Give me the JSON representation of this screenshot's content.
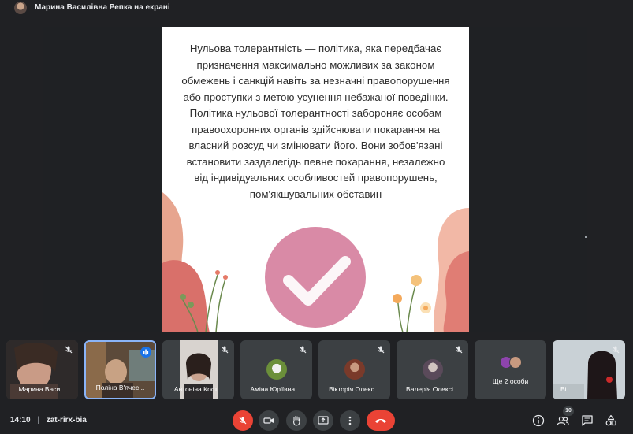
{
  "header": {
    "presenting_text": "Марина Василівна Репка на екрані"
  },
  "slide": {
    "text": "Нульова толерантність — політика, яка передбачає призначення максимально можливих за законом обмежень і санкцій навіть за незначні правопорушення або проступки з метою усунення небажаної поведінки. Політика нульової толерантності забороняє особам правоохоронних органів здійснювати покарання на власний розсуд чи змінювати його. Вони зобов'язані встановити заздалегідь певне покарання, незалежно від індивідуальних особливостей правопорушень, пом'якшувальних обставин",
    "check_color": "#d98aa6",
    "accent_color": "#e2a08f"
  },
  "participants": [
    {
      "name": "Марина Васи...",
      "muted": true
    },
    {
      "name": "Поліна В'ячес...",
      "muted": false,
      "speaking": true
    },
    {
      "name": "Антоніна Кост...",
      "muted": true
    },
    {
      "name": "Аміна Юріївна ...",
      "muted": true
    },
    {
      "name": "Вікторія Олекс...",
      "muted": true
    },
    {
      "name": "Валерія Олексі...",
      "muted": true
    },
    {
      "name": "Ще 2 особи",
      "muted": false
    },
    {
      "name": "Ві",
      "muted": true
    }
  ],
  "footer": {
    "time": "14:10",
    "separator": "|",
    "meeting_code": "zat-rirx-bia",
    "participant_count": "10"
  },
  "colors": {
    "background": "#202124",
    "control": "#3c4043",
    "danger": "#ea4335",
    "speaking": "#1a73e8"
  }
}
